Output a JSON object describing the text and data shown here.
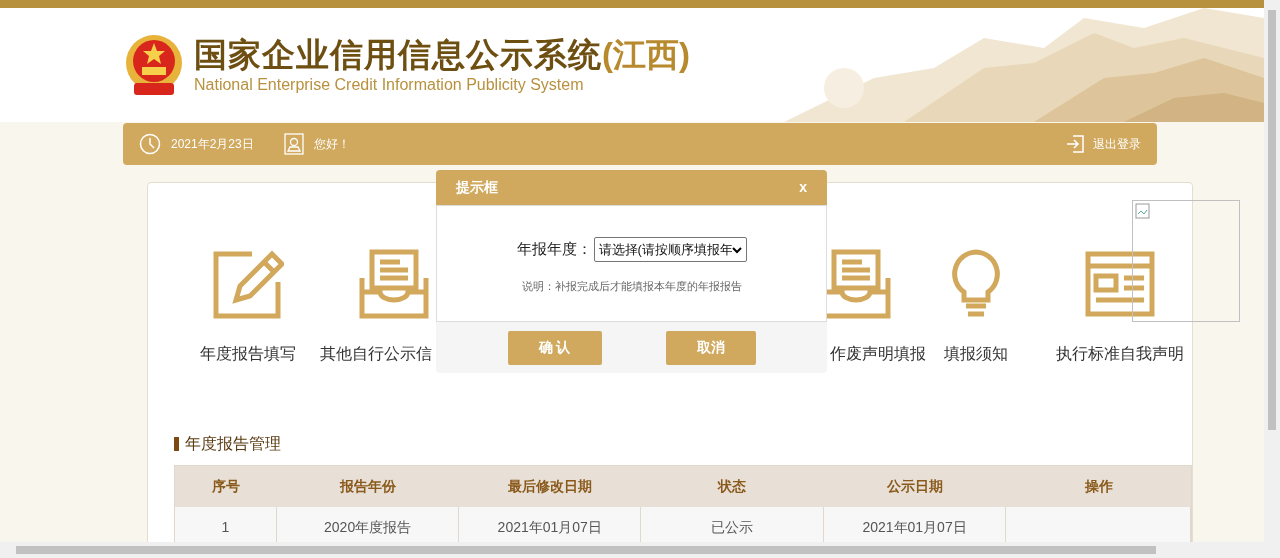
{
  "header": {
    "title": "国家企业信用信息公示系统",
    "region": "(江西)",
    "subtitle": "National Enterprise Credit Information Publicity System"
  },
  "navbar": {
    "date": "2021年2月23日",
    "greeting": "您好！",
    "logout": "退出登录"
  },
  "menu": [
    {
      "label": "年度报告填写",
      "kind": "edit"
    },
    {
      "label": "其他自行公示信",
      "kind": "inbox"
    },
    {
      "label": "作废声明填报",
      "kind": "inbox"
    },
    {
      "label": "填报须知",
      "kind": "bulb"
    },
    {
      "label": "执行标准自我声明",
      "kind": "page"
    }
  ],
  "dialog": {
    "title": "提示框",
    "close": "x",
    "field_label": "年报年度：",
    "select_value": "请选择(请按顺序填报年",
    "note": "说明：补报完成后才能填报本年度的年报报告",
    "buttons": [
      "确 认",
      "取消"
    ]
  },
  "section_title": "年度报告管理",
  "table": {
    "columns": [
      "序号",
      "报告年份",
      "最后修改日期",
      "状态",
      "公示日期",
      "操作"
    ],
    "rows": [
      [
        "1",
        "2020年度报告",
        "2021年01月07日",
        "已公示",
        "2021年01月07日"
      ]
    ]
  }
}
